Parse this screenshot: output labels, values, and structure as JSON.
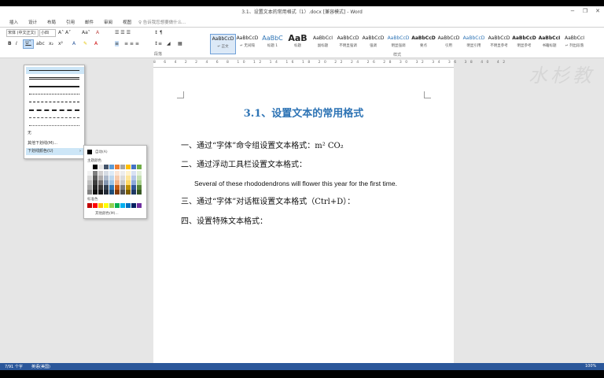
{
  "window": {
    "title": "3.1、设置文本的常用格式（1）.docx [兼容模式] - Word",
    "controls": [
      "−",
      "❐",
      "✕"
    ]
  },
  "tabs": [
    "插入",
    "设计",
    "布局",
    "引用",
    "邮件",
    "审阅",
    "视图"
  ],
  "tell_me": "告诉我您想要做什么...",
  "ribbon": {
    "font_name": "宋体 (中文正文)",
    "font_size": "小四",
    "font_group_label": "字体",
    "paragraph_group_label": "段落",
    "styles_group_label": "样式",
    "styles": [
      {
        "preview": "AaBbCcD",
        "name": "↵ 正文"
      },
      {
        "preview": "AaBbCcD",
        "name": "↵ 无间隔"
      },
      {
        "preview": "AaBbC",
        "name": "标题 1"
      },
      {
        "preview": "AaB",
        "name": "标题"
      },
      {
        "preview": "AaBbCcI",
        "name": "副标题"
      },
      {
        "preview": "AaBbCcD",
        "name": "不明显强调"
      },
      {
        "preview": "AaBbCcD",
        "name": "强调"
      },
      {
        "preview": "AaBbCcD",
        "name": "明显强调"
      },
      {
        "preview": "AaBbCcD",
        "name": "要点"
      },
      {
        "preview": "AaBbCcD",
        "name": "引用"
      },
      {
        "preview": "AaBbCcD",
        "name": "明显引用"
      },
      {
        "preview": "AaBbCcD",
        "name": "不明显参考"
      },
      {
        "preview": "AaBbCcD",
        "name": "明显参考"
      },
      {
        "preview": "AaBbCcI",
        "name": "书籍标题"
      },
      {
        "preview": "AaBbCcI",
        "name": "↵ 列出段落"
      }
    ]
  },
  "ruler": {
    "numbers": "8 6 4 2 2 4 6 8 10 12 14 16 18 20 22 24 26 28 30 32 34 36 38 40 42"
  },
  "document": {
    "title": "3.1、设置文本的常用格式",
    "lines": [
      "一、通过“字体”命令组设置文本格式：m² CO₂",
      "二、通过浮动工具栏设置文本格式：",
      "Several of these rhododendrons will flower this year for the first time.",
      "三、通过“字体”对话框设置文本格式（Ctrl+D）：",
      "四、设置特殊文本格式："
    ]
  },
  "underline_menu": {
    "none_label": "无",
    "more_label": "其他下划线(M)...",
    "color_label": "下划线颜色(U)"
  },
  "color_menu": {
    "auto_label": "自动(A)",
    "theme_label": "主题颜色",
    "standard_label": "标准色",
    "more_label": "其他颜色(M)...",
    "standard_colors": [
      "#c00000",
      "#ff0000",
      "#ffc000",
      "#ffff00",
      "#92d050",
      "#00b050",
      "#00b0f0",
      "#0070c0",
      "#002060",
      "#7030a0"
    ]
  },
  "status": {
    "pages": "第 1 页，共 1 页",
    "words": "7/91 个字",
    "language": "英语(美国)",
    "zoom": "100%"
  },
  "watermark": "水杉教"
}
